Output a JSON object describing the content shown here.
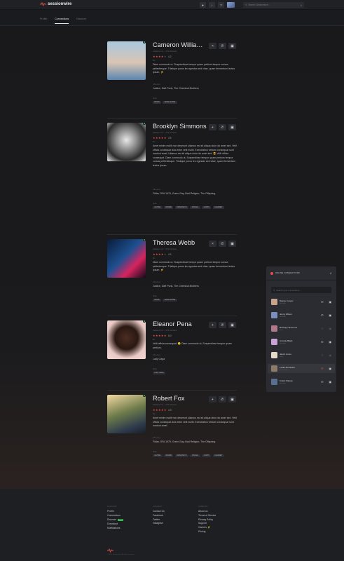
{
  "brand": {
    "name": "sessionwire",
    "accent": "#e2504a"
  },
  "header": {
    "icons": [
      "bell-icon",
      "download-icon",
      "help-icon"
    ],
    "search_placeholder": "Search Sessionwire..."
  },
  "tabs": [
    {
      "label": "Profile",
      "active": false
    },
    {
      "label": "Connections",
      "active": true
    },
    {
      "label": "Discover",
      "active": false
    }
  ],
  "profiles": [
    {
      "name": "Cameron Williamson",
      "meta": "Oakland, CA · 1,372 followers",
      "rating": 4.2,
      "stars_filled": 4,
      "bio_label": "Bio",
      "bio": "Diam commodo ut. Suspendisse tempor quam pretium tempor cursus pellentesque. Tristique purus leo egestas sed vitae, quam fermentum lectus ipsum. ⚡",
      "bands_label": "Influences",
      "bands": "Justice, Daft Punk, The Chemical Brothers",
      "tags_label": "Skills",
      "tags": [
        "DRUM",
        "BASS GUITAR"
      ],
      "added": true
    },
    {
      "name": "Brooklyn Simmons",
      "meta": "Oakland, CA · 1,372 followers",
      "rating": 4.9,
      "stars_filled": 5,
      "bio_label": "Bio",
      "bio": "Amet minim mollit non deserunt ullamco est sit aliqua dolor do amet sint. Velit officia consequat duis enim velit mollit. Exercitation veniam consequat sunt nostrud amet. Ullamco est sit aliqua dolor do amet sint. 😎 Velit officia consequat. Diam commodo ut, Suspendisse tempor quam pretium tempor cursus pellentesque. Tristique purus leo egestas sed vitae, quam fermentum lectus ipsum.",
      "bands_label": "Influences",
      "bands": "Fidlar, DFA 1979, Green Day, Bad Religion, The Offspring",
      "tags_label": "Skills",
      "tags": [
        "GUITAR",
        "DRUMS",
        "PIANO/KEYS",
        "VOCALS",
        "LOOPS",
        "CLARINET"
      ],
      "added": false
    },
    {
      "name": "Theresa Webb",
      "meta": "Oakland, CA · 1,372 followers",
      "rating": 4.2,
      "stars_filled": 4,
      "bio_label": "Bio",
      "bio": "Diam commodo ut. Suspendisse tempor quam pretium tempor cursus pellentesque. Tristique purus leo egestas sed vitae, quam fermentum lectus ipsum. ⚡",
      "bands_label": "Influences",
      "bands": "Justice, Daft Punk, The Chemical Brothers",
      "tags_label": "Skills",
      "tags": [
        "DRUM",
        "BASS GUITAR"
      ],
      "added": true
    },
    {
      "name": "Eleanor Pena",
      "meta": "Oakland, CA · 1,372 followers",
      "rating": 5.0,
      "stars_filled": 5,
      "bio_label": "Bio",
      "bio": "Velit officia consequat. 😐 Diam commodo ut, Suspendisse tempor quam pretium.",
      "bands_label": "Influences",
      "bands": "Lady Gaga",
      "tags_label": "Skills",
      "tags": [
        "LADY GAGA"
      ],
      "added": false
    },
    {
      "name": "Robert Fox",
      "meta": "Oakland, CA · 1,372 followers",
      "rating": 4.9,
      "stars_filled": 5,
      "bio_label": "Bio",
      "bio": "Amet minim mollit non deserunt ullamco est sit aliqua dolor do amet sint. Velit officia consequat duis enim velit mollit. Exercitation veniam consequat sunt nostrud amet.",
      "bands_label": "Influences",
      "bands": "Fidlar, DFA 1979, Green Day, Bad Religion, The Offspring",
      "tags_label": "Skills",
      "tags": [
        "GUITAR",
        "DRUMS",
        "PIANO/KEYS",
        "VOCALS",
        "LOOPS",
        "CLARINET"
      ],
      "added": false
    }
  ],
  "connections_panel": {
    "title": "ONLINE CONNECTIONS",
    "search_placeholder": "Search your connections...",
    "contacts": [
      {
        "name": "Bessie Cooper",
        "status": "Available",
        "online": true
      },
      {
        "name": "Jenny Wilson",
        "status": "Available",
        "online": true
      },
      {
        "name": "Brooklyn Simmons",
        "status": "Away",
        "online": false
      },
      {
        "name": "Annette Black",
        "status": "Available",
        "online": true
      },
      {
        "name": "Jacob Jones",
        "status": "Away",
        "online": false
      },
      {
        "name": "Leslie Alexander",
        "status": "In a session",
        "online": true,
        "in_call": true
      },
      {
        "name": "Kristin Watson",
        "status": "Available",
        "online": true
      }
    ]
  },
  "collapsed_panel": {
    "title": "ONLINE CONNECTIONS"
  },
  "footer": {
    "columns": [
      {
        "heading": "ACCOUNT",
        "links": [
          "Profile",
          "Connections",
          "Discover",
          "Download",
          "Notifications"
        ],
        "badge_on": "Discover",
        "badge": "NEW"
      },
      {
        "heading": "CONNECT",
        "links": [
          "Contact Us",
          "Facebook",
          "Twitter",
          "Instagram"
        ]
      },
      {
        "heading": "COMPANY",
        "links": [
          "About us",
          "Terms of Service",
          "Privacy Policy",
          "Support",
          "Careers ⚡",
          "Pricing"
        ]
      }
    ],
    "copyright": "© 2021 Sessionwire. All rights reserved."
  }
}
